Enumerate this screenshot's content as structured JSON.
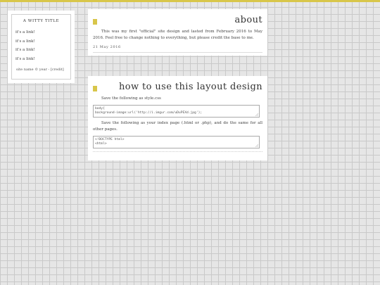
{
  "sidebar": {
    "title": "A WITTY TITLE",
    "links": [
      "it's a link!",
      "it's a link!",
      "it's a link!",
      "it's a link!"
    ],
    "credit": "site name © year - [credit]"
  },
  "posts": [
    {
      "title": "about",
      "body": "This was my first \"official\" site design and lasted from February 2016 to May 2016. Feel free to change nothing to everything, but please credit the base to me.",
      "date": "21 May 2016"
    },
    {
      "title": "how to use this layout design",
      "instruction1": "Save the following as style.css",
      "code1": "body{\nbackground-image:url('http://i.imgur.com/uDuPEXd.jpg');",
      "instruction2": "Save the following as your index page (.html or .php), and do the same for all other pages.",
      "code2": "<!DOCTYPE html>\n<html>"
    }
  ]
}
